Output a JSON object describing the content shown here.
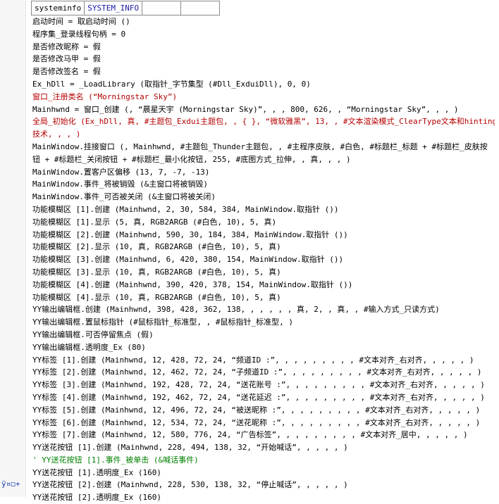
{
  "header": {
    "cells": [
      "systeminfo",
      "SYSTEM_INFO",
      "",
      ""
    ]
  },
  "gutter": {
    "icons_text": "ÿ¤◻+"
  },
  "lines": [
    {
      "text": "启动时间 = 取启动时间 ()",
      "color": "dark"
    },
    {
      "text": "程序集_登录线程句柄 = 0",
      "color": "dark"
    },
    {
      "text": "是否修改昵称 = 假",
      "color": "dark"
    },
    {
      "text": "是否修改马甲 = 假",
      "color": "dark"
    },
    {
      "text": "是否修改签名 = 假",
      "color": "dark"
    },
    {
      "text": "Ex_hDll = _LoadLibrary (取指针_字节集型 (#Dll_ExduiDll), 0, 0)",
      "color": "dark"
    },
    {
      "text": "窗口_注册类名 (“Morningstar Sky”)",
      "color": "red"
    },
    {
      "text": "Mainhwnd = 窗口_创建 (, “晨星天宇 (Morningstar Sky)”, , , 800, 626, , “Morningstar Sky”, , , )",
      "color": "dark"
    },
    {
      "text": "全局_初始化 (Ex_hDll, 真, #主题包_Exdui主题包, , { }, “微软雅黑”, 13, , #文本渲染模式_ClearType文本和hinting",
      "color": "red"
    },
    {
      "text": "技术, , , )",
      "color": "red"
    },
    {
      "text": "MainWindow.挂接窗口 (, Mainhwnd, #主题包_Thunder主题包, , #主程序皮肤, #白色, #标题栏_标题 + #标题栏_皮肤按",
      "color": "dark"
    },
    {
      "text": "钮 + #标题栏_关闭按钮 + #标题栏_最小化按钮, 255, #底图方式_拉伸, , 真, , , )",
      "color": "dark"
    },
    {
      "text": "MainWindow.置客户区偏移 (13, 7, -7, -13)",
      "color": "dark"
    },
    {
      "text": "MainWindow.事件_将被销毁 (&主窗口将被销毁)",
      "color": "dark"
    },
    {
      "text": "MainWindow.事件_可否被关闭 (&主窗口将被关闭)",
      "color": "dark"
    },
    {
      "text": "功能模糊区 [1].创建 (Mainhwnd, 2, 30, 584, 384, MainWindow.取指针 ())",
      "color": "dark"
    },
    {
      "text": "功能模糊区 [1].显示 (5, 真, RGB2ARGB (#白色, 10), 5, 真)",
      "color": "dark"
    },
    {
      "text": "功能模糊区 [2].创建 (Mainhwnd, 590, 30, 184, 384, MainWindow.取指针 ())",
      "color": "dark"
    },
    {
      "text": "功能模糊区 [2].显示 (10, 真, RGB2ARGB (#白色, 10), 5, 真)",
      "color": "dark"
    },
    {
      "text": "功能模糊区 [3].创建 (Mainhwnd, 6, 420, 380, 154, MainWindow.取指针 ())",
      "color": "dark"
    },
    {
      "text": "功能模糊区 [3].显示 (10, 真, RGB2ARGB (#白色, 10), 5, 真)",
      "color": "dark"
    },
    {
      "text": "功能模糊区 [4].创建 (Mainhwnd, 390, 420, 378, 154, MainWindow.取指针 ())",
      "color": "dark"
    },
    {
      "text": "功能模糊区 [4].显示 (10, 真, RGB2ARGB (#白色, 10), 5, 真)",
      "color": "dark"
    },
    {
      "text": "YY输出编辑框.创建 (Mainhwnd, 398, 428, 362, 138, , , , , , 真, 2, , 真, , #输入方式_只读方式)",
      "color": "dark"
    },
    {
      "text": "YY输出编辑框.置鼠标指针 (#鼠标指针_标准型, , #鼠标指针_标准型, )",
      "color": "dark"
    },
    {
      "text": "YY输出编辑框.可否停留焦点 (假)",
      "color": "dark"
    },
    {
      "text": "YY输出编辑框.透明度_Ex (80)",
      "color": "dark"
    },
    {
      "text": "YY标签 [1].创建 (Mainhwnd, 12, 428, 72, 24, “频道ID :”, , , , , , , , , #文本对齐_右对齐, , , , , )",
      "color": "dark"
    },
    {
      "text": "YY标签 [2].创建 (Mainhwnd, 12, 462, 72, 24, “子频道ID :”, , , , , , , , , #文本对齐_右对齐, , , , , )",
      "color": "dark"
    },
    {
      "text": "YY标签 [3].创建 (Mainhwnd, 192, 428, 72, 24, “送花账号 :”, , , , , , , , , #文本对齐_右对齐, , , , , )",
      "color": "dark"
    },
    {
      "text": "YY标签 [4].创建 (Mainhwnd, 192, 462, 72, 24, “送花延迟 :”, , , , , , , , , #文本对齐_右对齐, , , , , )",
      "color": "dark"
    },
    {
      "text": "YY标签 [5].创建 (Mainhwnd, 12, 496, 72, 24, “被送昵称 :”, , , , , , , , , #文本对齐_右对齐, , , , , )",
      "color": "dark"
    },
    {
      "text": "YY标签 [6].创建 (Mainhwnd, 12, 534, 72, 24, “送花昵称 :”, , , , , , , , , #文本对齐_右对齐, , , , , )",
      "color": "dark"
    },
    {
      "text": "YY标签 [7].创建 (Mainhwnd, 12, 580, 776, 24, “广告标签”, , , , , , , , , #文本对齐_居中, , , , , )",
      "color": "dark"
    },
    {
      "text": "YY送花按钮 [1].创建 (Mainhwnd, 228, 494, 138, 32, “开始喊话”, , , , , )",
      "color": "dark"
    },
    {
      "text": "' YY送花按钮 [1].事件_被单击 (&喊话事件)",
      "color": "green"
    },
    {
      "text": "YY送花按钮 [1].透明度_Ex (160)",
      "color": "dark"
    },
    {
      "text": "YY送花按钮 [2].创建 (Mainhwnd, 228, 530, 138, 32, “停止喊话”, , , , , )",
      "color": "dark"
    },
    {
      "text": "YY送花按钮 [2].透明度_Ex (160)",
      "color": "dark"
    }
  ]
}
